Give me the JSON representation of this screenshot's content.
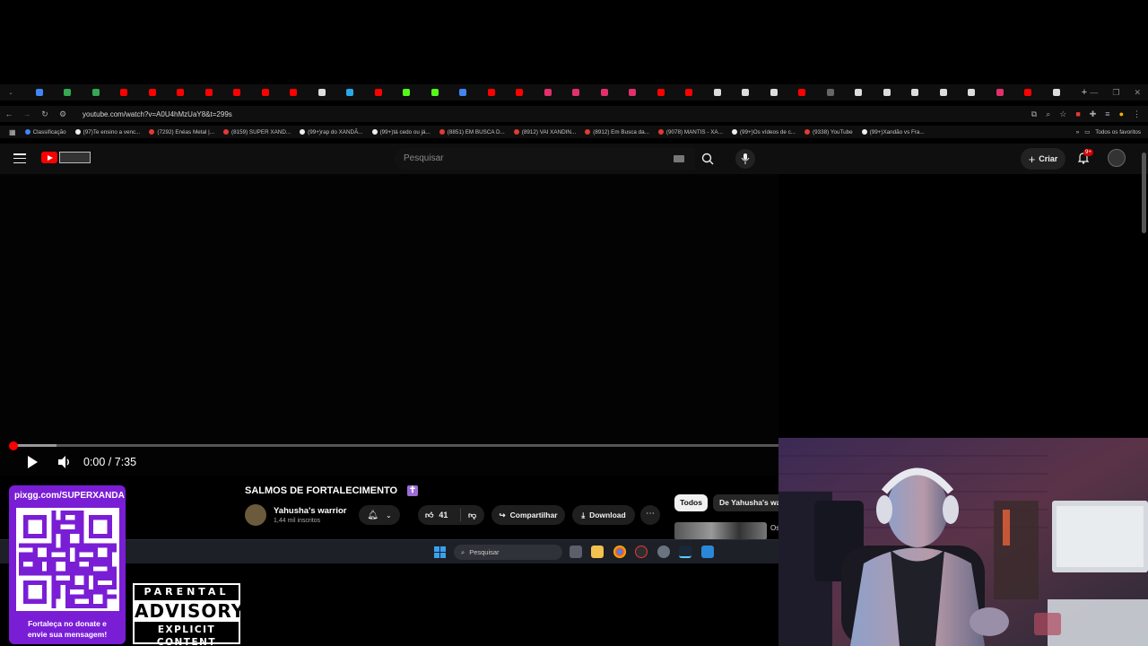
{
  "browser": {
    "url": "youtube.com/watch?v=A0U4hMzUaY8&t=299s",
    "bookmarks": [
      "Classificação",
      "(97)Te ensino a venc...",
      "(7292) Enéas Metal |...",
      "(8159) SUPER XAND...",
      "(99+)rap do XANDÃ...",
      "(99+)tá cedo ou já...",
      "(8851) EM BUSCA D...",
      "(8912) VAI XANDIN...",
      "(8912) Em Busca da...",
      "(9078) MANTIS - XA...",
      "(99+)Os vídeos de c...",
      "(9338) YouTube",
      "(99+)Xandão vs Fra..."
    ],
    "bookmarks_all": "Todos os favoritos"
  },
  "youtube": {
    "search_placeholder": "Pesquisar",
    "create_label": "Criar",
    "notification_count": "9+"
  },
  "player": {
    "time": "0:00 / 7:35",
    "progress": 0.0
  },
  "video": {
    "title": "SALMOS DE FORTALECIMENTO",
    "channel": "Yahusha's warrior",
    "subscribers": "1,44 mil inscritos",
    "likes": "41",
    "share_label": "Compartilhar",
    "download_label": "Download",
    "more_label": "⋯"
  },
  "sidebar": {
    "chip_all": "Todos",
    "chip_channel": "De Yahusha's warrior",
    "next_video_text": "Os"
  },
  "taskbar": {
    "search_label": "Pesquisar"
  },
  "overlay": {
    "donate_url": "pixgg.com/SUPERXANDA",
    "donate_message_line1": "Fortaleça no donate e",
    "donate_message_line2": "envie sua mensagem!",
    "advisory_top": "PARENTAL",
    "advisory_mid": "ADVISORY",
    "advisory_bot": "EXPLICIT CONTENT"
  }
}
